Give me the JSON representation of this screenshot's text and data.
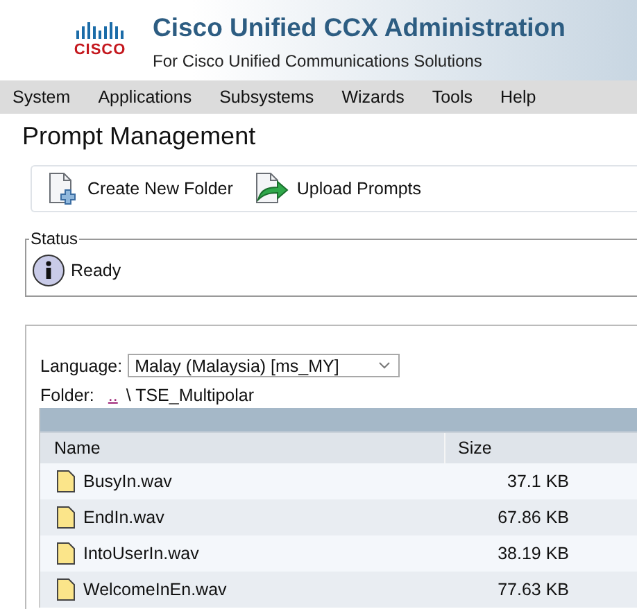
{
  "header": {
    "logo_text": "CISCO",
    "title": "Cisco Unified CCX Administration",
    "subtitle": "For Cisco Unified Communications Solutions"
  },
  "menu": [
    "System",
    "Applications",
    "Subsystems",
    "Wizards",
    "Tools",
    "Help"
  ],
  "page_title": "Prompt Management",
  "toolbar": [
    {
      "label": "Create New Folder",
      "kind": "new-folder"
    },
    {
      "label": "Upload Prompts",
      "kind": "upload"
    }
  ],
  "status": {
    "legend": "Status",
    "message": "Ready"
  },
  "language": {
    "label": "Language:",
    "value": "Malay (Malaysia) [ms_MY]"
  },
  "folder": {
    "label": "Folder:",
    "parent_link": "..",
    "separator": "\\",
    "name": "TSE_Multipolar"
  },
  "table": {
    "columns": [
      "Name",
      "Size"
    ],
    "rows": [
      {
        "name": "BusyIn.wav",
        "size": "37.1 KB"
      },
      {
        "name": "EndIn.wav",
        "size": "67.86 KB"
      },
      {
        "name": "IntoUserIn.wav",
        "size": "38.19 KB"
      },
      {
        "name": "WelcomeInEn.wav",
        "size": "77.63 KB"
      }
    ]
  }
}
